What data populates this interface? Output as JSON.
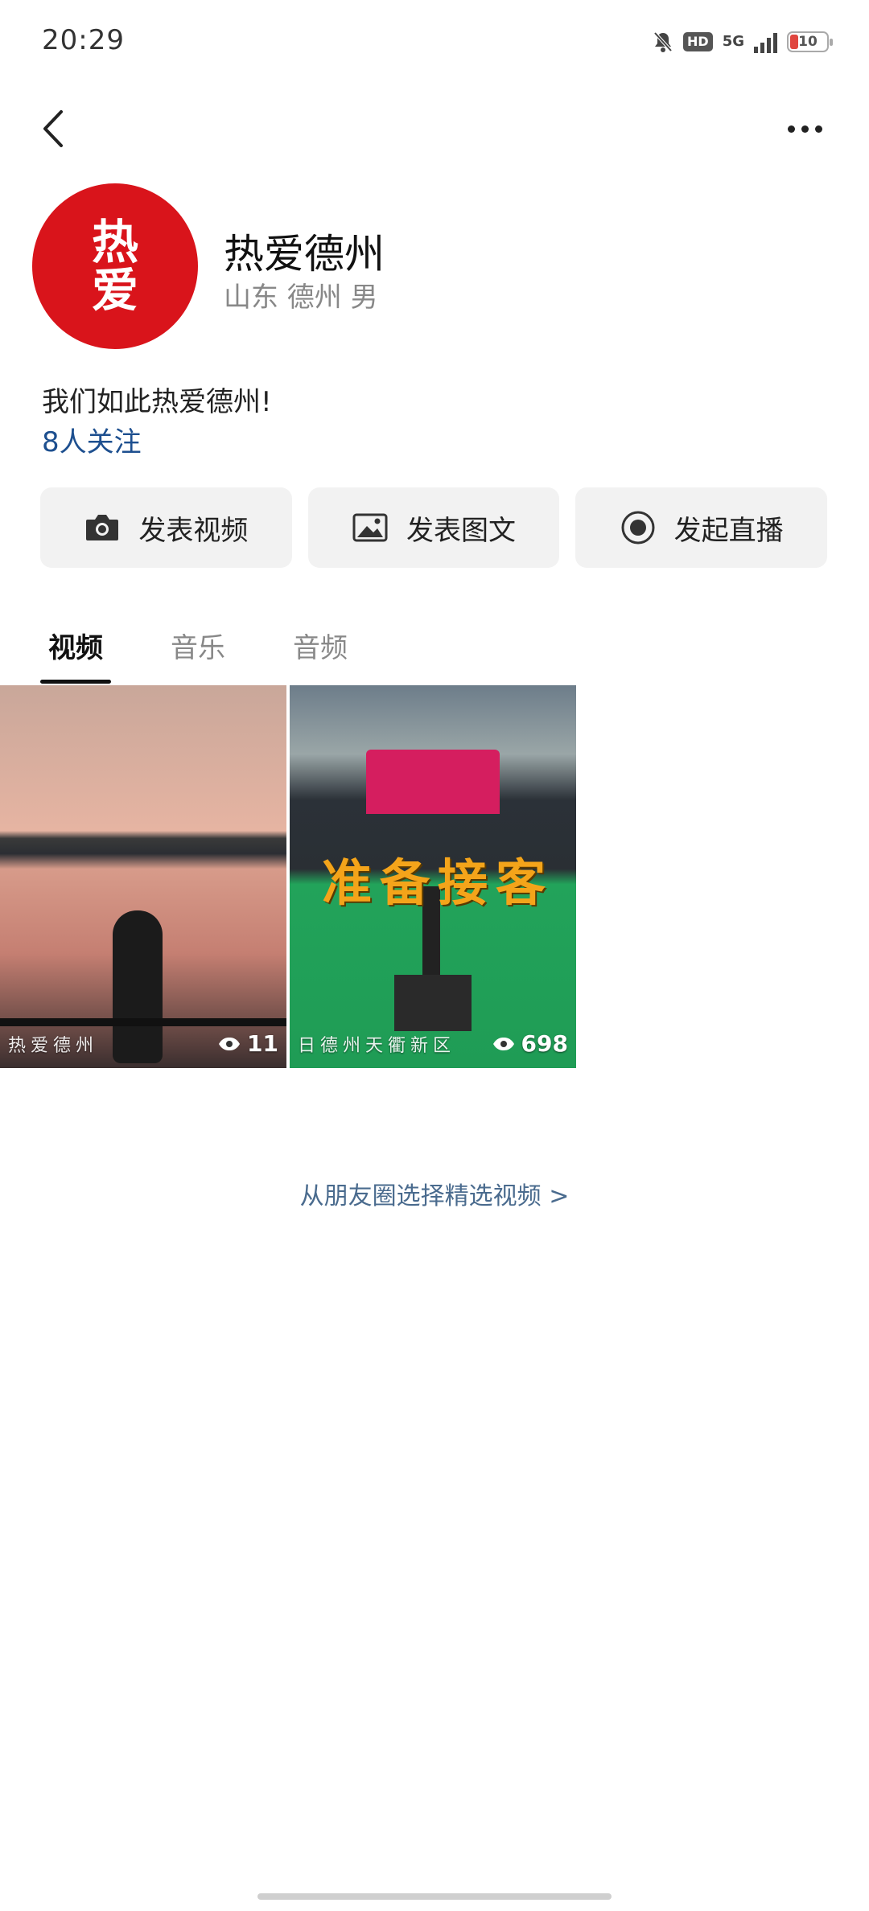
{
  "status_bar": {
    "time": "20:29",
    "hd_label": "HD",
    "network_label": "5G",
    "battery_level": "10"
  },
  "nav": {
    "back_icon": "chevron-left-icon",
    "more_icon": "more-dots-icon"
  },
  "profile": {
    "avatar_text_line1": "热",
    "avatar_text_line2": "爱",
    "name": "热爱德州",
    "location": "山东 德州 男",
    "bio": "我们如此热爱德州!",
    "followers": "8人关注"
  },
  "actions": [
    {
      "label": "发表视频",
      "icon": "camera-icon"
    },
    {
      "label": "发表图文",
      "icon": "image-icon"
    },
    {
      "label": "发起直播",
      "icon": "live-record-icon"
    }
  ],
  "tabs": [
    {
      "label": "视频",
      "active": true
    },
    {
      "label": "音乐",
      "active": false
    },
    {
      "label": "音频",
      "active": false
    }
  ],
  "videos": [
    {
      "caption": "热爱德州",
      "views": "11"
    },
    {
      "caption": "日德州天衢新区",
      "views": "698",
      "overlay_title": "准备接客"
    }
  ],
  "select_link": "从朋友圈选择精选视频 >",
  "colors": {
    "avatar_bg": "#d9141b",
    "link_blue": "#1d4f8f",
    "button_bg": "#f2f2f2"
  }
}
